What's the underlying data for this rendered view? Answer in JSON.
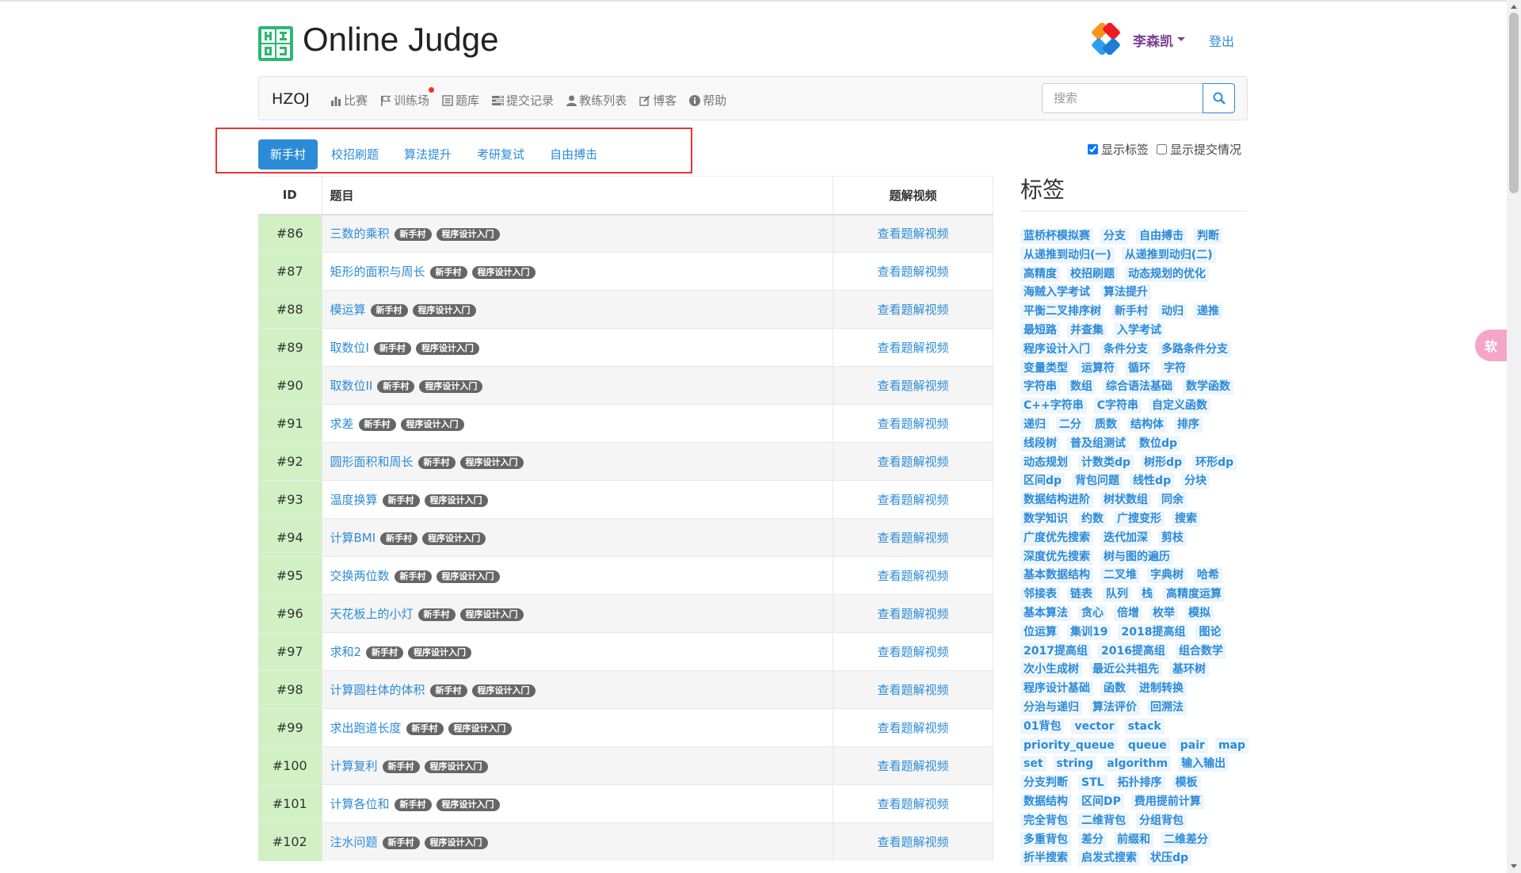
{
  "site": {
    "title": "Online Judge"
  },
  "user": {
    "name": "李森凯",
    "logout": "登出"
  },
  "navbar": {
    "brand": "HZOJ",
    "items": [
      {
        "label": "比赛",
        "icon": "bar-chart-icon"
      },
      {
        "label": "训练场",
        "icon": "flag-icon"
      },
      {
        "label": "题库",
        "icon": "list-icon"
      },
      {
        "label": "提交记录",
        "icon": "tasks-icon"
      },
      {
        "label": "教练列表",
        "icon": "user-icon"
      },
      {
        "label": "博客",
        "icon": "edit-icon"
      },
      {
        "label": "帮助",
        "icon": "info-icon"
      }
    ],
    "search_placeholder": "搜索"
  },
  "tabs": [
    {
      "label": "新手村",
      "active": true
    },
    {
      "label": "校招刷题",
      "active": false
    },
    {
      "label": "算法提升",
      "active": false
    },
    {
      "label": "考研复试",
      "active": false
    },
    {
      "label": "自由搏击",
      "active": false
    }
  ],
  "options": {
    "show_tags": "显示标签",
    "show_tags_checked": true,
    "show_submit": "显示提交情况",
    "show_submit_checked": false
  },
  "table": {
    "headers": {
      "id": "ID",
      "title": "题目",
      "video": "题解视频"
    },
    "rows": [
      {
        "id": "#86",
        "title": "三数的乘积",
        "badges": [
          "新手村",
          "程序设计入门"
        ],
        "video": "查看题解视频"
      },
      {
        "id": "#87",
        "title": "矩形的面积与周长",
        "badges": [
          "新手村",
          "程序设计入门"
        ],
        "video": "查看题解视频"
      },
      {
        "id": "#88",
        "title": "模运算",
        "badges": [
          "新手村",
          "程序设计入门"
        ],
        "video": "查看题解视频"
      },
      {
        "id": "#89",
        "title": "取数位I",
        "badges": [
          "新手村",
          "程序设计入门"
        ],
        "video": "查看题解视频"
      },
      {
        "id": "#90",
        "title": "取数位II",
        "badges": [
          "新手村",
          "程序设计入门"
        ],
        "video": "查看题解视频"
      },
      {
        "id": "#91",
        "title": "求差",
        "badges": [
          "新手村",
          "程序设计入门"
        ],
        "video": "查看题解视频"
      },
      {
        "id": "#92",
        "title": "圆形面积和周长",
        "badges": [
          "新手村",
          "程序设计入门"
        ],
        "video": "查看题解视频"
      },
      {
        "id": "#93",
        "title": "温度换算",
        "badges": [
          "新手村",
          "程序设计入门"
        ],
        "video": "查看题解视频"
      },
      {
        "id": "#94",
        "title": "计算BMI",
        "badges": [
          "新手村",
          "程序设计入门"
        ],
        "video": "查看题解视频"
      },
      {
        "id": "#95",
        "title": "交换两位数",
        "badges": [
          "新手村",
          "程序设计入门"
        ],
        "video": "查看题解视频"
      },
      {
        "id": "#96",
        "title": "天花板上的小灯",
        "badges": [
          "新手村",
          "程序设计入门"
        ],
        "video": "查看题解视频"
      },
      {
        "id": "#97",
        "title": "求和2",
        "badges": [
          "新手村",
          "程序设计入门"
        ],
        "video": "查看题解视频"
      },
      {
        "id": "#98",
        "title": "计算圆柱体的体积",
        "badges": [
          "新手村",
          "程序设计入门"
        ],
        "video": "查看题解视频"
      },
      {
        "id": "#99",
        "title": "求出跑道长度",
        "badges": [
          "新手村",
          "程序设计入门"
        ],
        "video": "查看题解视频"
      },
      {
        "id": "#100",
        "title": "计算复利",
        "badges": [
          "新手村",
          "程序设计入门"
        ],
        "video": "查看题解视频"
      },
      {
        "id": "#101",
        "title": "计算各位和",
        "badges": [
          "新手村",
          "程序设计入门"
        ],
        "video": "查看题解视频"
      },
      {
        "id": "#102",
        "title": "注水问题",
        "badges": [
          "新手村",
          "程序设计入门"
        ],
        "video": "查看题解视频"
      }
    ]
  },
  "tags_panel": {
    "heading": "标签",
    "rows": [
      [
        "蓝桥杯模拟赛",
        "分支",
        "自由搏击",
        "判断"
      ],
      [
        "从递推到动归(一)",
        "从递推到动归(二)"
      ],
      [
        "高精度",
        "校招刷题",
        "动态规划的优化"
      ],
      [
        "海贼入学考试",
        "算法提升"
      ],
      [
        "平衡二叉排序树",
        "新手村",
        "动归",
        "递推"
      ],
      [
        "最短路",
        "并查集",
        "入学考试"
      ],
      [
        "程序设计入门",
        "条件分支",
        "多路条件分支"
      ],
      [
        "变量类型",
        "运算符",
        "循环",
        "字符"
      ],
      [
        "字符串",
        "数组",
        "综合语法基础",
        "数学函数"
      ],
      [
        "C++字符串",
        "C字符串",
        "自定义函数"
      ],
      [
        "递归",
        "二分",
        "质数",
        "结构体",
        "排序"
      ],
      [
        "线段树",
        "普及组测试",
        "数位dp"
      ],
      [
        "动态规划",
        "计数类dp",
        "树形dp",
        "环形dp"
      ],
      [
        "区间dp",
        "背包问题",
        "线性dp",
        "分块"
      ],
      [
        "数据结构进阶",
        "树状数组",
        "同余"
      ],
      [
        "数学知识",
        "约数",
        "广搜变形",
        "搜索"
      ],
      [
        "广度优先搜索",
        "迭代加深",
        "剪枝"
      ],
      [
        "深度优先搜索",
        "树与图的遍历"
      ],
      [
        "基本数据结构",
        "二叉堆",
        "字典树",
        "哈希"
      ],
      [
        "邻接表",
        "链表",
        "队列",
        "栈",
        "高精度运算"
      ],
      [
        "基本算法",
        "贪心",
        "倍增",
        "枚举",
        "模拟"
      ],
      [
        "位运算",
        "集训19",
        "2018提高组",
        "图论"
      ],
      [
        "2017提高组",
        "2016提高组",
        "组合数学"
      ],
      [
        "次小生成树",
        "最近公共祖先",
        "基环树"
      ],
      [
        "程序设计基础",
        "函数",
        "进制转换"
      ],
      [
        "分治与递归",
        "算法评价",
        "回溯法"
      ],
      [
        "01背包",
        "vector",
        "stack"
      ],
      [
        "priority_queue",
        "queue",
        "pair",
        "map"
      ],
      [
        "set",
        "string",
        "algorithm",
        "输入输出"
      ],
      [
        "分支判断",
        "STL",
        "拓扑排序",
        "模板"
      ],
      [
        "数据结构",
        "区间DP",
        "费用提前计算"
      ],
      [
        "完全背包",
        "二维背包",
        "分组背包"
      ],
      [
        "多重背包",
        "差分",
        "前缀和",
        "二维差分"
      ],
      [
        "折半搜索",
        "启发式搜索",
        "状压dp"
      ]
    ]
  },
  "float_button": "软",
  "colors": {
    "accent": "#2c8bd7",
    "id_cell": "#d1f1c4",
    "badge": "#666666",
    "highlight_box": "#ee3333",
    "username": "#7d4196"
  }
}
